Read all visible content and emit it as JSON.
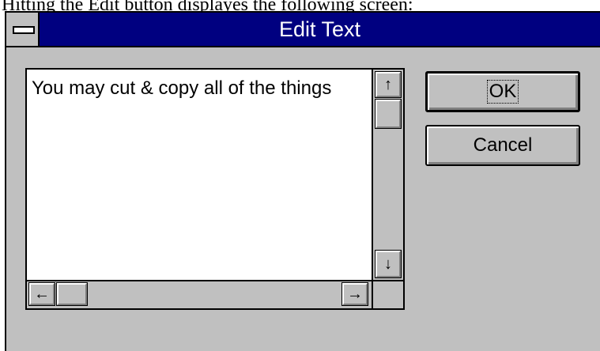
{
  "caption": "Hitting the Edit button displayes the following screen:",
  "window": {
    "title": "Edit Text",
    "system_menu_icon": "system-menu-icon"
  },
  "editor": {
    "text": "You may cut & copy all of the things"
  },
  "scrollbars": {
    "up_arrow": "↑",
    "down_arrow": "↓",
    "left_arrow": "←",
    "right_arrow": "→"
  },
  "buttons": {
    "ok_label": "OK",
    "cancel_label": "Cancel"
  },
  "colors": {
    "title_bar": "#000080",
    "face": "#c0c0c0",
    "text_background": "#ffffff"
  }
}
